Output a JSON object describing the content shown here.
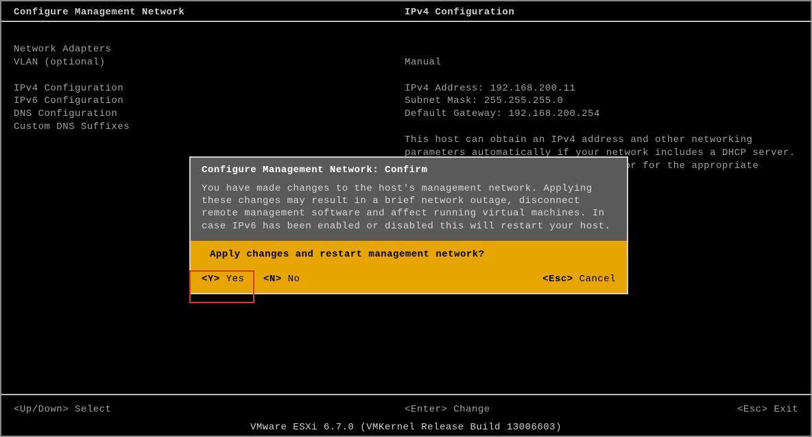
{
  "header": {
    "left_title": "Configure Management Network",
    "right_title": "IPv4 Configuration"
  },
  "menu": {
    "items": [
      "Network Adapters",
      "VLAN (optional)",
      "",
      "IPv4 Configuration",
      "IPv6 Configuration",
      "DNS Configuration",
      "Custom DNS Suffixes"
    ]
  },
  "details": {
    "mode": "Manual",
    "ipv4_label": "IPv4 Address:",
    "ipv4_value": "192.168.200.11",
    "subnet_label": "Subnet Mask:",
    "subnet_value": "255.255.255.0",
    "gateway_label": "Default Gateway:",
    "gateway_value": "192.168.200.254",
    "description": "This host can obtain an IPv4 address and other networking parameters automatically if your network includes a DHCP server. If not, ask your network administrator for the appropriate settings."
  },
  "dialog": {
    "title": "Configure Management Network: Confirm",
    "body": "You have made changes to the host's management network. Applying these changes may result in a brief network outage, disconnect remote management software and affect running virtual machines. In case IPv6 has been enabled or disabled this will restart your host.",
    "question": "Apply changes and restart management network?",
    "yes_key": "<Y>",
    "yes_label": "Yes",
    "no_key": "<N>",
    "no_label": "No",
    "cancel_key": "<Esc>",
    "cancel_label": "Cancel"
  },
  "footer": {
    "select_key": "<Up/Down>",
    "select_label": "Select",
    "change_key": "<Enter>",
    "change_label": "Change",
    "exit_key": "<Esc>",
    "exit_label": "Exit"
  },
  "version_line": "VMware ESXi 6.7.0 (VMKernel Release Build 13006603)"
}
